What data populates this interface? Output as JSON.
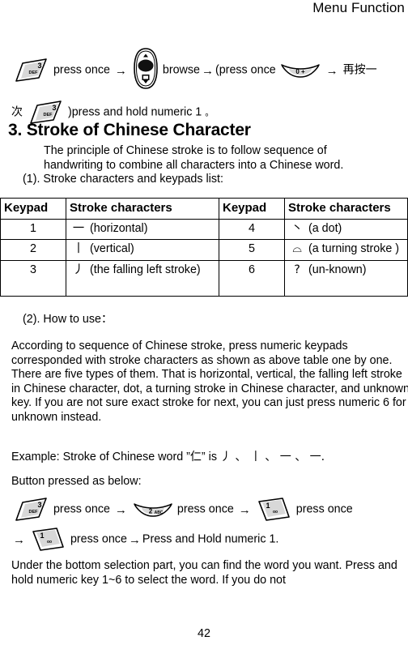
{
  "header": {
    "title": "Menu Function"
  },
  "intro_sequence": {
    "key3_icon": "keypad-3-def-icon",
    "text1": "press once",
    "arrow1": "→",
    "nav_icon": "phone-navigation-key-icon",
    "text2": "browse",
    "arrow2": "→",
    "text3": "(press once",
    "key0_icon": "keypad-0-plus-icon",
    "arrow3": "→",
    "cjk1": "再按一",
    "cjk2": "次",
    "key3_icon_b": "keypad-3-def-icon",
    "text4": ")press and hold numeric 1",
    "cjk_period": "。"
  },
  "section": {
    "title": "3. Stroke of Chinese Character",
    "paragraph1": "The principle of Chinese stroke is to follow sequence of handwriting to combine all characters into a Chinese word.",
    "paragraph2": "(1). Stroke characters and keypads list:"
  },
  "table": {
    "headers": [
      "Keypad",
      "Stroke characters",
      "Keypad",
      "Stroke characters"
    ],
    "rows": [
      {
        "keypad_left": "1",
        "glyph_left": "一",
        "label_left": "(horizontal)",
        "keypad_right": "4",
        "glyph_right": "丶",
        "label_right": "(a dot)"
      },
      {
        "keypad_left": "2",
        "glyph_left": "丨",
        "label_left": "(vertical)",
        "keypad_right": "5",
        "glyph_right": "⌓",
        "label_right": "(a turning stroke )"
      },
      {
        "keypad_left": "3",
        "glyph_left": "丿",
        "label_left": "(the falling left stroke)",
        "keypad_right": "6",
        "glyph_right": "?",
        "label_right": "(un-known)"
      }
    ]
  },
  "howto": {
    "heading": "(2). How to use：",
    "paragraph": "According to sequence of Chinese stroke, press numeric keypads corresponded with stroke characters as shown as above table one by one.    There are five types of them. That is horizontal, vertical, the falling left stroke in Chinese character, dot, a turning stroke in Chinese character, and unknown key. If you are not sure exact stroke for next, you can just press numeric 6 for unknown instead.",
    "example_prefix": "Example: Stroke of Chinese word ”",
    "example_word": "仁",
    "example_mid": "” is ",
    "example_strokes": "丿 、 丨 、 一 、 一.",
    "button_label": "Button pressed as below:"
  },
  "button_sequence": {
    "key3_icon": "keypad-3-def-icon",
    "text1": "press once",
    "arrow1": "→",
    "key2_icon": "keypad-2-abc-icon",
    "text2": "press once",
    "arrow2": "→",
    "key1_icon": "keypad-1-icon",
    "text3": "press once",
    "arrow3": "→",
    "key1_icon_b": "keypad-1-icon",
    "text4": "press once",
    "arrow4": "→",
    "text5": "Press and Hold numeric 1."
  },
  "closing": {
    "paragraph": "Under the bottom selection part, you can find the word you want. Press and hold numeric key 1~6 to select the word. If you do not"
  },
  "footer": {
    "page_number": "42"
  }
}
